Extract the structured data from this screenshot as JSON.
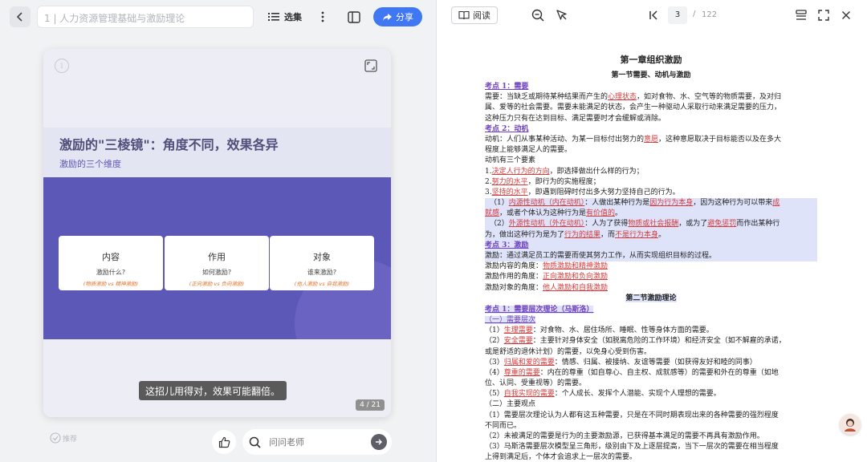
{
  "left": {
    "title": "1 | 人力资源管理基础与激励理论",
    "xuanji_label": "选集",
    "share_label": "分享",
    "card": {
      "title": "激励的\"三棱镜\"：角度不同，效果各异",
      "subtitle": "激励的三个维度",
      "dimensions": [
        {
          "name": "内容",
          "question": "激励什么?",
          "example": "(物质激励 vs 精神激励)"
        },
        {
          "name": "作用",
          "question": "如何激励?",
          "example": "(正向激励 vs 负向激励)"
        },
        {
          "name": "对象",
          "question": "谁来激励?",
          "example": "(他人激励 vs 自我激励)"
        }
      ],
      "caption": "这招儿用得对，效果可能翻倍。",
      "page_indicator": "4 / 21"
    },
    "bottom": {
      "recommend_label": "推荐",
      "ask_placeholder": "问问老师"
    }
  },
  "right": {
    "read_label": "阅读",
    "current_page": "3",
    "page_separator": "/",
    "total_pages": "122",
    "doc": {
      "chapter": "第一章组织激励",
      "section1": "第一节需要、动机与激励",
      "kp1": "考点 1：需要",
      "kp1_l1_a": "需要：当缺乏或期待某种结果而产生的",
      "kp1_l1_red": "心理状态",
      "kp1_l1_b": "，如对食物、水、空气等的物质需要，及对归",
      "kp1_l2": "属、爱等的社会需要。需要未能满足的状态，会产生一种驱动人采取行动来满足需要的压力，",
      "kp1_l3": "这种压力只有在达到目标、满足需要时才会缓解或消除。",
      "kp2": "考点 2：动机",
      "kp2_l1_a": "动机：人们从事某种活动、为某一目标付出努力的",
      "kp2_l1_red": "意愿",
      "kp2_l1_b": "，这种意愿取决于目标能否以及在多大",
      "kp2_l2": "程度上能够满足人的需要。",
      "kp2_l3": "动机有三个要素",
      "e1_a": "1.",
      "e1_red": "决定人行为的方向",
      "e1_b": "，即选择做出什么样的行为；",
      "e2_a": "2.",
      "e2_red": "努力的水平",
      "e2_b": "，即行为的实施程度；",
      "e3_a": "3.",
      "e3_red": "坚持的水平",
      "e3_b": "，即遇到阻碍时付出多大努力坚持自己的行为。",
      "in1_a": "（1）",
      "in1_red": "内源性动机（内在动机）",
      "in1_b": "：人做出某种行为是",
      "in1_red2": "因为行为本身",
      "in1_c": "，因为这种行为可以带来",
      "in1_red3": "成",
      "in1_l2_red": "就感",
      "in1_l2_b": "，或者个体认为这种行为是",
      "in1_l2_red2": "有价值的",
      "in1_l2_c": "。",
      "ex1_a": "（2）",
      "ex1_red": "外源性动机（外在动机）",
      "ex1_b": "：人为了获得",
      "ex1_red2": "物质或社会报酬",
      "ex1_c": "，或为了",
      "ex1_red3": "避免惩罚",
      "ex1_d": "而作出某种行",
      "ex1_l2_a": "为，做出这种行为是为了",
      "ex1_l2_red": "行为的结果",
      "ex1_l2_b": "，而",
      "ex1_l2_red2": "不是行为本身",
      "ex1_l2_c": "。",
      "kp3": "考点 3：激励",
      "kp3_l1": "激励：通过满足员工的需要而使其努力工作，从而实现组织目标的过程。",
      "kp3_l2_a": "激励内容的角度：",
      "kp3_l2_red": "物质激励和精神激励",
      "kp3_l3_a": "激励作用的角度：",
      "kp3_l3_red": "正向激励和负向激励",
      "kp3_l4_a": "激励对象的角度：",
      "kp3_l4_red": "他人激励和自我激励",
      "section2": "第二节激励理论",
      "kp4": "考点 1：需要层次理论（马斯洛）",
      "sub1": "（一）需要层次",
      "n1_a": "（1）",
      "n1_red": "生理需要",
      "n1_b": "：对食物、水、居住场所、睡眠、性等身体方面的需要。",
      "n2_a": "（2）",
      "n2_red": "安全需要",
      "n2_b": "：主要针对身体安全（如脱离危险的工作环境）和经济安全（如不解雇的承诺，",
      "n2_l2": "或是舒适的退休计划）的需要，以免身心受到伤害。",
      "n3_a": "（3）",
      "n3_red": "归属和爱的需要",
      "n3_b": "：情感、归属、被接纳、友谊等需要（如获得友好和睦的同事）",
      "n4_a": "（4）",
      "n4_red": "尊重的需要",
      "n4_b": "：内在的尊重（如自尊心、自主权、成就感等）的需要和外在的尊重（如地",
      "n4_l2": "位、认同、受重视等）的需要。",
      "n5_a": "（5）",
      "n5_red": "自我实现的需要",
      "n5_b": "：个人成长、发挥个人潜能、实现个人理想的需要。",
      "sub2": "（二）主要观点",
      "v1": "（1）需要层次理论认为人都有这五种需要，只是在不同时期表现出来的各种需要的强烈程度",
      "v1_l2": "不同而已。",
      "v2": "（2）未被满足的需要是行为的主要激励源，已获得基本满足的需要不再具有激励作用。",
      "v3": "（3）马斯洛需要层次模型呈三角形，级别由下及上逐层提高，当下一层次的需要在相当程度",
      "v3_l2": "上得到满足后，个体才会追求上一层次的需要。"
    }
  },
  "colors": {
    "accent": "#3f78f2",
    "card_purple": "#5b58b7",
    "keypoint": "#6e3fbe",
    "emphasis_red": "#d63a3a",
    "highlight": "#dfe3fa"
  },
  "icons": [
    "back-chevron-icon",
    "list-icon",
    "more-icon",
    "layout-icon",
    "share-icon",
    "info-icon",
    "fullscreen-icon",
    "recommend-icon",
    "thumb-up-icon",
    "search-icon",
    "arrow-right-icon",
    "book-icon",
    "zoom-out-icon",
    "cursor-icon",
    "first-page-icon",
    "toc-icon",
    "expand-icon",
    "close-icon",
    "teacher-avatar-icon"
  ]
}
